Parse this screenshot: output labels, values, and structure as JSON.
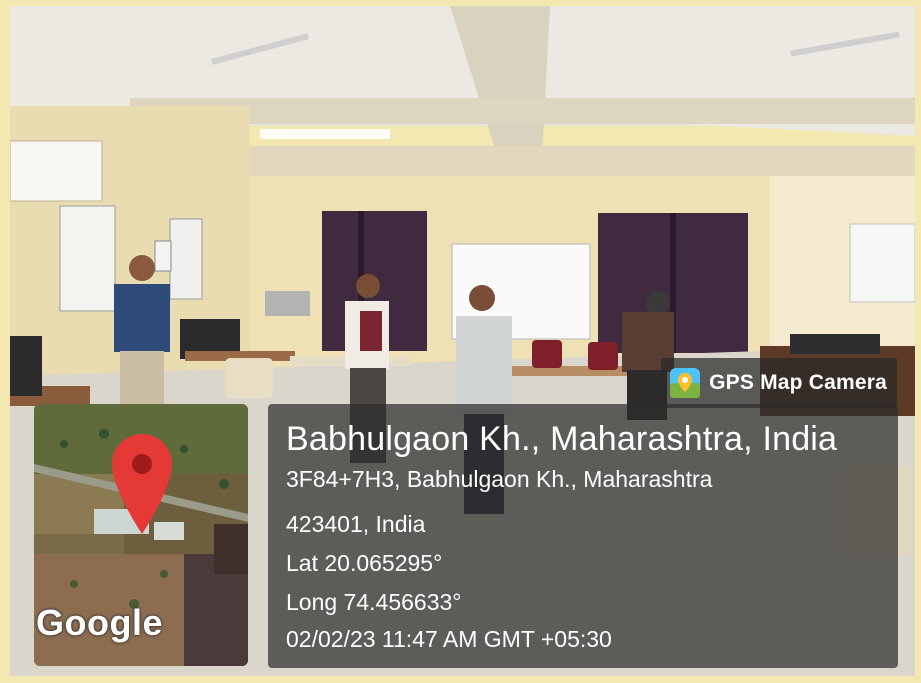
{
  "badge": {
    "label": "GPS Map Camera",
    "icon": "map-pin-camera-icon"
  },
  "map": {
    "attribution": "Google",
    "marker_icon": "location-pin-icon"
  },
  "location": {
    "title": "Babhulgaon Kh., Maharashtra, India",
    "address_line1": "3F84+7H3, Babhulgaon Kh., Maharashtra",
    "address_line2": "423401, India",
    "latitude": "Lat 20.065295°",
    "longitude": "Long 74.456633°",
    "timestamp": "02/02/23 11:47 AM GMT +05:30"
  },
  "colors": {
    "overlay": "#2d2d2d",
    "pin": "#e53935",
    "frame": "#f3e9b0"
  }
}
